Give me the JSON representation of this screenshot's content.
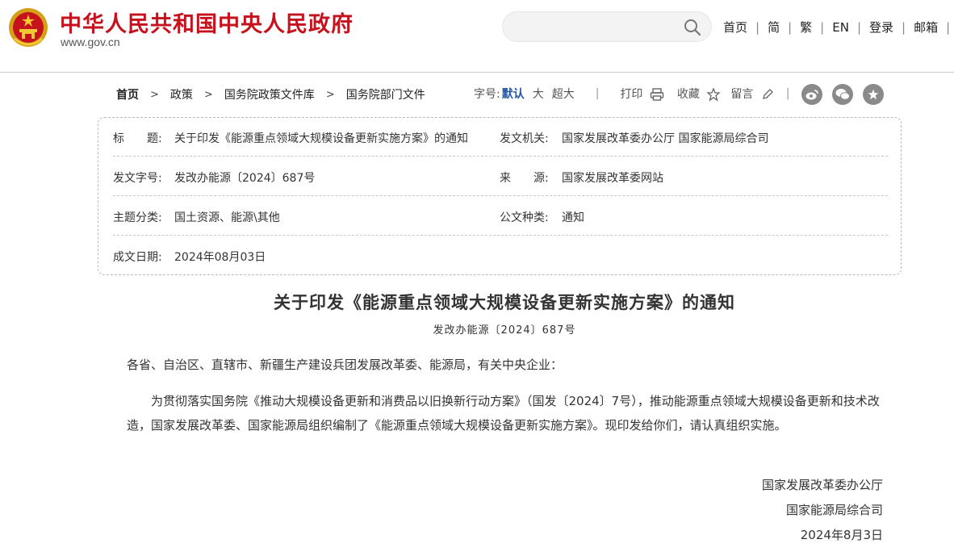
{
  "header": {
    "site_title": "中华人民共和国中央人民政府",
    "site_url": "www.gov.cn",
    "search_placeholder": "",
    "nav": [
      "首页",
      "简",
      "繁",
      "EN",
      "登录",
      "邮箱"
    ],
    "nav_overflow": "无"
  },
  "breadcrumb": {
    "items": [
      "首页",
      "政策",
      "国务院政策文件库",
      "国务院部门文件"
    ]
  },
  "tools": {
    "font_size_label": "字号:",
    "font_default": "默认",
    "font_large": "大",
    "font_xlarge": "超大",
    "print_label": "打印",
    "favorite_label": "收藏",
    "comment_label": "留言",
    "accent_color": "#2156a5"
  },
  "info": {
    "title_key": "标　　题:",
    "title_value": "关于印发《能源重点领域大规模设备更新实施方案》的通知",
    "issuer_key": "发文机关:",
    "issuer_value": "国家发展改革委办公厅 国家能源局综合司",
    "doc_no_key": "发文字号:",
    "doc_no_value": "发改办能源〔2024〕687号",
    "source_key": "来　　源:",
    "source_value": "国家发展改革委网站",
    "topic_key": "主题分类:",
    "topic_value": "国土资源、能源\\其他",
    "type_key": "公文种类:",
    "type_value": "通知",
    "date_key": "成文日期:",
    "date_value": "2024年08月03日"
  },
  "article": {
    "title": "关于印发《能源重点领域大规模设备更新实施方案》的通知",
    "doc_no": "发改办能源〔2024〕687号",
    "salutation": "各省、自治区、直辖市、新疆生产建设兵团发展改革委、能源局，有关中央企业：",
    "body": "为贯彻落实国务院《推动大规模设备更新和消费品以旧换新行动方案》（国发〔2024〕7号），推动能源重点领域大规模设备更新和技术改造，国家发展改革委、国家能源局组织编制了《能源重点领域大规模设备更新实施方案》。现印发给你们，请认真组织实施。",
    "signature_1": "国家发展改革委办公厅",
    "signature_2": "国家能源局综合司",
    "signature_date": "2024年8月3日"
  },
  "colors": {
    "brand_red": "#c6121c",
    "social_grey": "#8a8a8a"
  }
}
